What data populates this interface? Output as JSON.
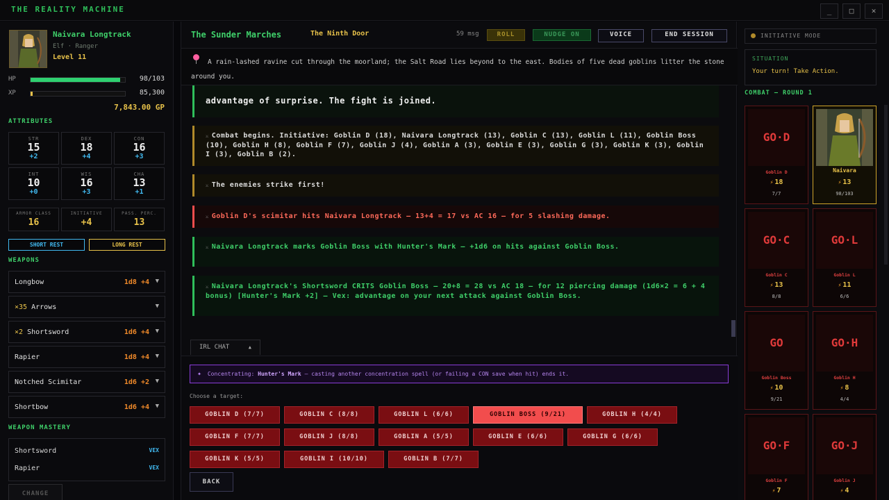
{
  "app": {
    "title": "THE REALITY MACHINE"
  },
  "window": {
    "minimize": "_",
    "maximize": "□",
    "close": "✕"
  },
  "character": {
    "name": "Naivara Longtrack",
    "class": "Elf · Ranger",
    "level": "Level 11",
    "hp_label": "HP",
    "hp": "98/103",
    "hp_fraction": 0.951,
    "xp_label": "XP",
    "xp": "85,300",
    "xp_fraction": 0.02,
    "gold": "7,843.00 GP"
  },
  "attributes": {
    "header": "ATTRIBUTES",
    "items": [
      {
        "abbr": "STR",
        "score": "15",
        "mod": "+2"
      },
      {
        "abbr": "DEX",
        "score": "18",
        "mod": "+4"
      },
      {
        "abbr": "CON",
        "score": "16",
        "mod": "+3"
      },
      {
        "abbr": "INT",
        "score": "10",
        "mod": "+0"
      },
      {
        "abbr": "WIS",
        "score": "16",
        "mod": "+3"
      },
      {
        "abbr": "CHA",
        "score": "13",
        "mod": "+1"
      }
    ],
    "derived": [
      {
        "abbr": "ARMOR CLASS",
        "value": "16"
      },
      {
        "abbr": "INITIATIVE",
        "value": "+4"
      },
      {
        "abbr": "PASS. PERC.",
        "value": "13"
      }
    ],
    "short_rest": "SHORT REST",
    "long_rest": "LONG REST"
  },
  "weapons": {
    "header": "WEAPONS",
    "items": [
      {
        "qty": "",
        "name": "Longbow",
        "dmg": "1d8 +4"
      },
      {
        "qty": "×35",
        "name": "Arrows",
        "dmg": ""
      },
      {
        "qty": "×2",
        "name": "Shortsword",
        "dmg": "1d6 +4"
      },
      {
        "qty": "",
        "name": "Rapier",
        "dmg": "1d8 +4"
      },
      {
        "qty": "",
        "name": "Notched Scimitar",
        "dmg": "1d6 +2"
      },
      {
        "qty": "",
        "name": "Shortbow",
        "dmg": "1d6 +4"
      }
    ],
    "chevron": "▼"
  },
  "mastery": {
    "header": "WEAPON MASTERY",
    "items": [
      {
        "name": "Shortsword",
        "tag": "VEX"
      },
      {
        "name": "Rapier",
        "tag": "VEX"
      }
    ],
    "change": "CHANGE"
  },
  "location": {
    "title": "The Sunder Marches",
    "subtitle": "The Ninth Door",
    "msg_count": "59 msg",
    "roll": "ROLL",
    "nudge": "NUDGE ON",
    "voice": "VOICE",
    "end_session": "END SESSION",
    "scene": "A rain-lashed ravine cut through the moorland; the Salt Road lies beyond to the east. Bodies of five dead goblins litter the stone around you."
  },
  "log": [
    {
      "kind": "narration",
      "icon": "",
      "text": "advantage of surprise. The fight is joined."
    },
    {
      "kind": "system",
      "icon": "⚔",
      "text": "Combat begins. Initiative: Goblin D (18), Naivara Longtrack (13), Goblin C (13), Goblin L (11), Goblin Boss (10), Goblin H (8), Goblin F (7), Goblin J (4), Goblin A (3), Goblin E (3), Goblin G (3), Goblin K (3), Goblin I (3), Goblin B (2)."
    },
    {
      "kind": "system",
      "icon": "⚔",
      "text": "The enemies strike first!"
    },
    {
      "kind": "enemy",
      "icon": "⚔",
      "text": "Goblin D's scimitar hits Naivara Longtrack — 13+4 = 17 vs AC 16 — for 5 slashing damage."
    },
    {
      "kind": "player",
      "icon": "⚔",
      "text": "Naivara Longtrack marks Goblin Boss with Hunter's Mark — +1d6 on hits against Goblin Boss."
    },
    {
      "kind": "player",
      "icon": "⚔",
      "text": "Naivara Longtrack's Shortsword CRITS Goblin Boss — 20+8 = 28 vs AC 18 — for 12 piercing damage (1d6×2 = 6 + 4 bonus) [Hunter's Mark +2] — Vex: advantage on your next attack against Goblin Boss."
    }
  ],
  "irl_chat": {
    "label": "IRL CHAT",
    "chevron": "▲"
  },
  "concentration": {
    "icon": "✦",
    "label": "Concentrating:",
    "spell": "Hunter's Mark",
    "text": "— casting another concentration spell (or failing a CON save when hit) ends it."
  },
  "targets": {
    "prompt": "Choose a target:",
    "items": [
      {
        "label": "GOBLIN D (7/7)",
        "selected": false
      },
      {
        "label": "GOBLIN C (8/8)",
        "selected": false
      },
      {
        "label": "GOBLIN L (6/6)",
        "selected": false
      },
      {
        "label": "GOBLIN BOSS (9/21)",
        "selected": true
      },
      {
        "label": "GOBLIN H (4/4)",
        "selected": false
      },
      {
        "label": "GOBLIN F (7/7)",
        "selected": false
      },
      {
        "label": "GOBLIN J (8/8)",
        "selected": false
      },
      {
        "label": "GOBLIN A (5/5)",
        "selected": false
      },
      {
        "label": "GOBLIN E (6/6)",
        "selected": false
      },
      {
        "label": "GOBLIN G (6/6)",
        "selected": false
      },
      {
        "label": "GOBLIN K (5/5)",
        "selected": false
      },
      {
        "label": "GOBLIN I (10/10)",
        "selected": false
      },
      {
        "label": "GOBLIN B (7/7)",
        "selected": false
      }
    ],
    "back": "BACK"
  },
  "initiative": {
    "mode": "INITIATIVE MODE",
    "situation_header": "SITUATION",
    "situation": "Your turn! Take Action.",
    "round": "COMBAT — ROUND 1",
    "cards": [
      {
        "art": "GO·D",
        "name": "Goblin D",
        "init": "18",
        "hp": "7/7",
        "active": false
      },
      {
        "art": "",
        "name": "Naivara",
        "init": "13",
        "hp": "98/103",
        "active": true
      },
      {
        "art": "GO·C",
        "name": "Goblin C",
        "init": "13",
        "hp": "8/8",
        "active": false
      },
      {
        "art": "GO·L",
        "name": "Goblin L",
        "init": "11",
        "hp": "6/6",
        "active": false
      },
      {
        "art": "GO",
        "name": "Goblin Boss",
        "init": "10",
        "hp": "9/21",
        "active": false
      },
      {
        "art": "GO·H",
        "name": "Goblin H",
        "init": "8",
        "hp": "4/4",
        "active": false
      },
      {
        "art": "GO·F",
        "name": "Goblin F",
        "init": "7",
        "hp": "",
        "active": false
      },
      {
        "art": "GO·J",
        "name": "Goblin J",
        "init": "4",
        "hp": "",
        "active": false
      }
    ],
    "bolt": "⚡"
  },
  "colors": {
    "green": "#3fd06a",
    "gold": "#e8c24a",
    "blue": "#41b9f0",
    "red": "#f24d4d",
    "purple": "#8a3dd8"
  }
}
